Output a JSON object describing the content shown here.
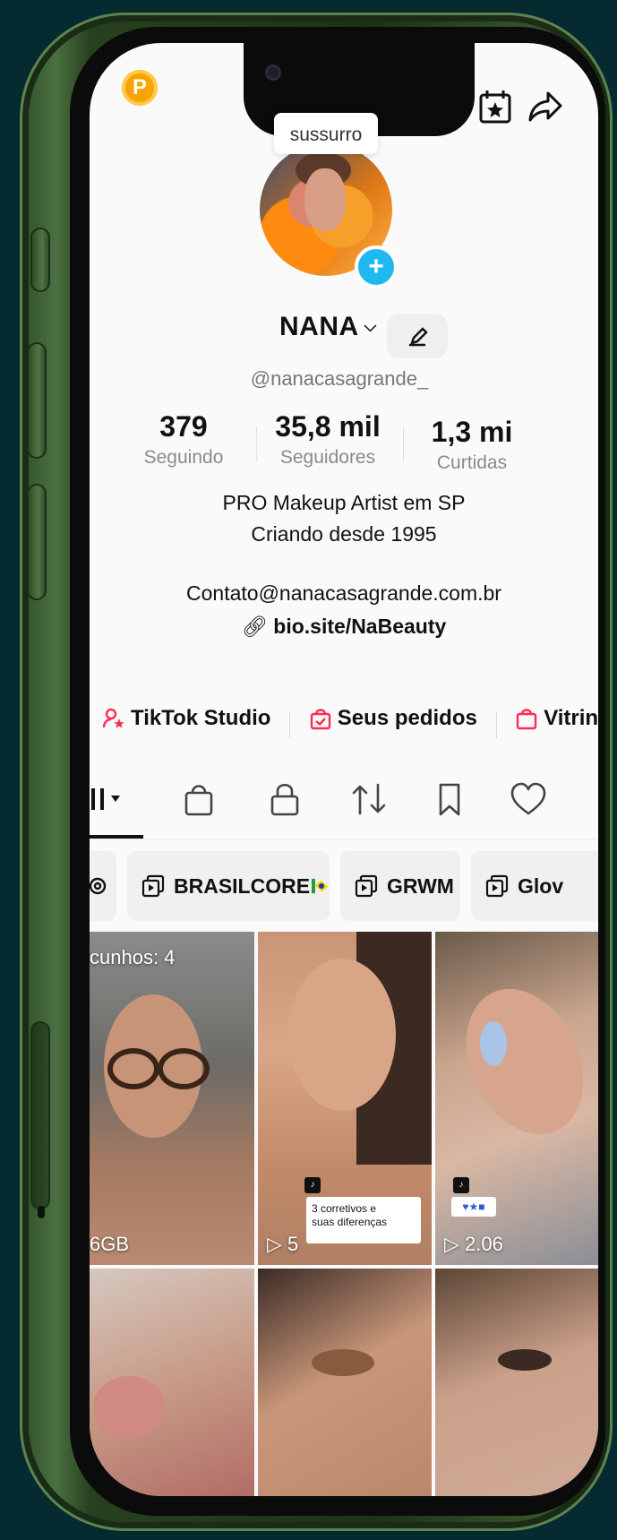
{
  "profile": {
    "sticker": "sussurro",
    "name": "NANA",
    "handle": "@nanacasagrande_",
    "stats": [
      {
        "value": "379",
        "label": "Seguindo"
      },
      {
        "value": "35,8 mil",
        "label": "Seguidores"
      },
      {
        "value": "1,3 mi",
        "label": "Curtidas"
      }
    ],
    "bio_line1": "PRO Makeup Artist em SP",
    "bio_line2": "Criando desde 1995",
    "contact": "Contato@nanacasagrande.com.br",
    "link": "bio.site/NaBeauty"
  },
  "shortcuts": {
    "studio": "TikTok Studio",
    "orders": "Seus pedidos",
    "showcase": "Vitrine"
  },
  "collections": {
    "brasilcore": "BRASILCORE",
    "grwm": "GRWM",
    "glow": "Glov"
  },
  "grid": {
    "drafts": "cunhos: 4",
    "size_label": "6GB",
    "play_count_2": "5",
    "caption_2_line1": "3 corretivos e",
    "caption_2_line2": "suas diferenças",
    "play_count_3": "2.06"
  },
  "colors": {
    "accent_red": "#fe2c55",
    "plus_blue": "#20b8f0",
    "coin": "#f5a400"
  }
}
